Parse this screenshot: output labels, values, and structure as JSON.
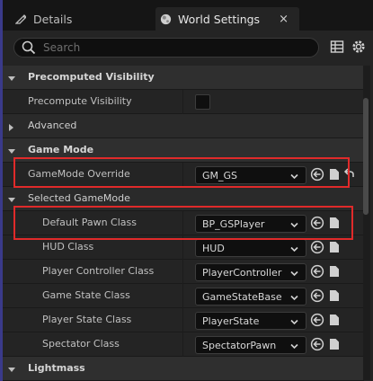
{
  "tabs": {
    "details": {
      "label": "Details"
    },
    "world": {
      "label": "World Settings",
      "close": "×"
    }
  },
  "search": {
    "placeholder": "Search"
  },
  "rows": [
    {
      "kind": "category",
      "label": "Precomputed Visibility"
    },
    {
      "kind": "prop",
      "label": "Precompute Visibility",
      "checkbox": false
    },
    {
      "kind": "sub",
      "label": "Advanced"
    },
    {
      "kind": "category",
      "label": "Game Mode"
    },
    {
      "kind": "prop",
      "label": "GameMode Override",
      "value": "GM_GS"
    },
    {
      "kind": "sub",
      "label": "Selected GameMode"
    },
    {
      "kind": "prop",
      "label": "Default Pawn Class",
      "value": "BP_GSPlayer"
    },
    {
      "kind": "prop",
      "label": "HUD Class",
      "value": "HUD"
    },
    {
      "kind": "prop",
      "label": "Player Controller Class",
      "value": "PlayerController"
    },
    {
      "kind": "prop",
      "label": "Game State Class",
      "value": "GameStateBase"
    },
    {
      "kind": "prop",
      "label": "Player State Class",
      "value": "PlayerState"
    },
    {
      "kind": "prop",
      "label": "Spectator Class",
      "value": "SpectatorPawn"
    },
    {
      "kind": "category",
      "label": "Lightmass"
    }
  ],
  "colors": {
    "highlight": "#e02a2a",
    "panel": "#242424",
    "category": "#2f2f2f"
  }
}
